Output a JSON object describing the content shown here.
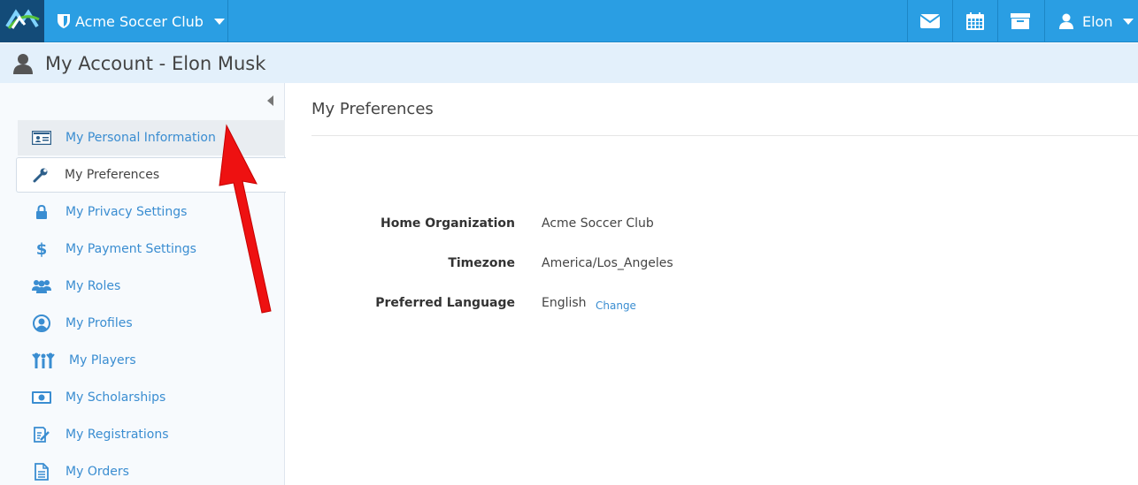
{
  "topbar": {
    "org_name": "Acme Soccer Club",
    "user_name": "Elon",
    "brand_color": "#2a9ee3"
  },
  "page": {
    "title": "My Account - Elon Musk"
  },
  "sidebar": {
    "items": [
      {
        "label": "My Personal Information",
        "icon": "id-card-icon"
      },
      {
        "label": "My Preferences",
        "icon": "wrench-icon"
      },
      {
        "label": "My Privacy Settings",
        "icon": "lock-icon"
      },
      {
        "label": "My Payment Settings",
        "icon": "dollar-icon"
      },
      {
        "label": "My Roles",
        "icon": "users-icon"
      },
      {
        "label": "My Profiles",
        "icon": "user-circle-icon"
      },
      {
        "label": "My Players",
        "icon": "players-icon"
      },
      {
        "label": "My Scholarships",
        "icon": "money-icon"
      },
      {
        "label": "My Registrations",
        "icon": "edit-icon"
      },
      {
        "label": "My Orders",
        "icon": "document-icon"
      }
    ]
  },
  "content": {
    "title": "My Preferences",
    "fields": [
      {
        "label": "Home Organization",
        "value": "Acme Soccer Club"
      },
      {
        "label": "Timezone",
        "value": "America/Los_Angeles"
      },
      {
        "label": "Preferred Language",
        "value": "English"
      }
    ],
    "change_link": "Change"
  }
}
